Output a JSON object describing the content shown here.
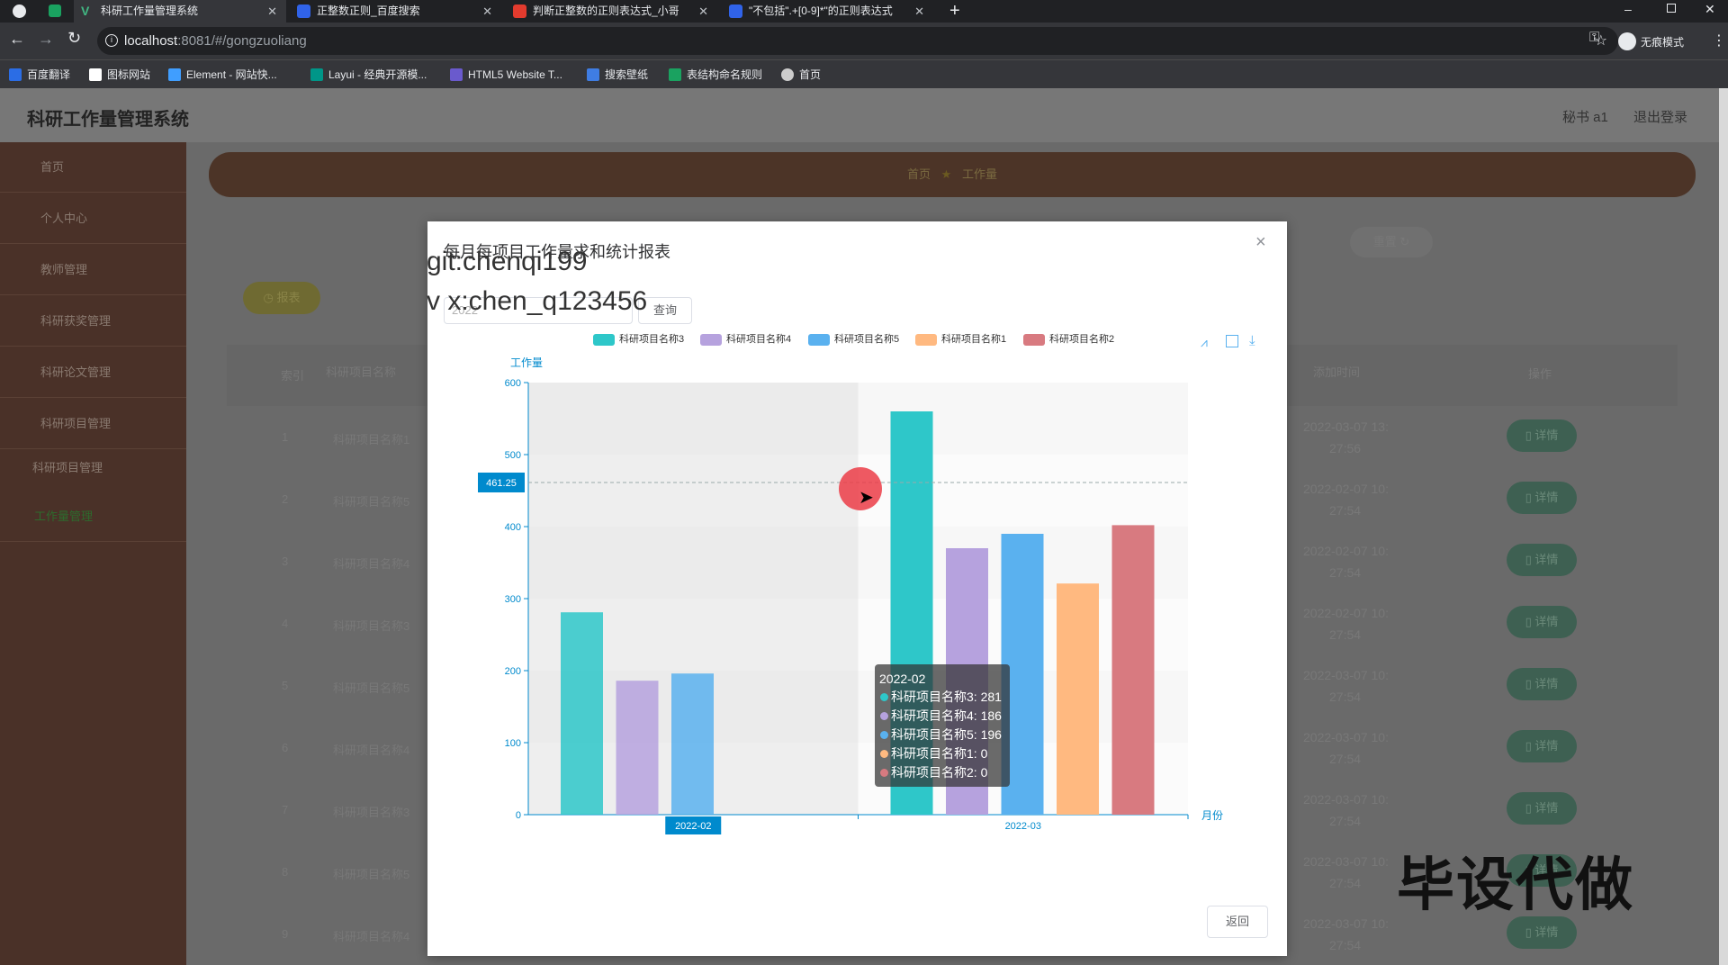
{
  "browser": {
    "tabs": [
      {
        "title": "科研工作量管理系统",
        "active": true,
        "fav": "#1aa260"
      },
      {
        "title": "正整数正则_百度搜索",
        "active": false,
        "fav": "#3063e9"
      },
      {
        "title": "判断正整数的正则表达式_小哥",
        "active": false,
        "fav": "#e33b2e"
      },
      {
        "title": "\"不包括\".+[0-9]*\"的正则表达式",
        "active": false,
        "fav": "#3063e9"
      }
    ],
    "url_host": "localhost",
    "url_rest": ":8081/#/gongzuoliang",
    "incognito_label": "无痕模式",
    "bookmarks": [
      {
        "label": "百度翻译",
        "color": "#2b6de5"
      },
      {
        "label": "图标网站",
        "color": "#ffffff"
      },
      {
        "label": "Element - 网站快...",
        "color": "#409eff"
      },
      {
        "label": "Layui - 经典开源模...",
        "color": "#009688"
      },
      {
        "label": "HTML5 Website T...",
        "color": "#6a5acd"
      },
      {
        "label": "搜索壁纸",
        "color": "#3f7de3"
      },
      {
        "label": "表结构命名规则",
        "color": "#1aa260"
      },
      {
        "label": "首页",
        "color": "#cccccc"
      }
    ]
  },
  "app": {
    "title": "科研工作量管理系统",
    "user": "秘书 a1",
    "logout": "退出登录",
    "menu": [
      "首页",
      "个人中心",
      "教师管理",
      "科研获奖管理",
      "科研论文管理",
      "科研项目管理",
      "科研项目管理",
      "工作量管理"
    ],
    "breadcrumb_home": "首页",
    "breadcrumb_current": "工作量",
    "reset_label": "重置",
    "report_label": "报表",
    "table": {
      "headers": [
        "索引",
        "科研项目名称",
        "添加时间",
        "操作"
      ],
      "rows": [
        {
          "index": "1",
          "name": "科研项目名称1",
          "time1": "2022-03-07 13:",
          "time2": "27:56"
        },
        {
          "index": "2",
          "name": "科研项目名称5",
          "time1": "2022-02-07 10:",
          "time2": "27:54"
        },
        {
          "index": "3",
          "name": "科研项目名称4",
          "time1": "2022-02-07 10:",
          "time2": "27:54"
        },
        {
          "index": "4",
          "name": "科研项目名称3",
          "time1": "2022-02-07 10:",
          "time2": "27:54"
        },
        {
          "index": "5",
          "name": "科研项目名称5",
          "time1": "2022-03-07 10:",
          "time2": "27:54"
        },
        {
          "index": "6",
          "name": "科研项目名称4",
          "time1": "2022-03-07 10:",
          "time2": "27:54"
        },
        {
          "index": "7",
          "name": "科研项目名称3",
          "time1": "2022-03-07 10:",
          "time2": "27:54"
        },
        {
          "index": "8",
          "name": "科研项目名称5",
          "time1": "2022-03-07 10:",
          "time2": "27:54"
        },
        {
          "index": "9",
          "name": "科研项目名称4",
          "time1": "2022-03-07 10:",
          "time2": "27:54"
        }
      ],
      "detail_label": "详情"
    }
  },
  "modal": {
    "title": "每月每项目工作量求和统计报表",
    "close": "×",
    "year_value": "2022",
    "query_label": "查询",
    "back_label": "返回"
  },
  "watermarks": {
    "line1": "git:chenqi199",
    "line2": "v x:chen_q123456",
    "corner": "毕设代做"
  },
  "tooltip": {
    "title": "2022-02",
    "rows": [
      "科研项目名称3: 281",
      "科研项目名称4: 186",
      "科研项目名称5: 196",
      "科研项目名称1: 0",
      "科研项目名称2: 0"
    ]
  },
  "chart_data": {
    "type": "bar",
    "ylabel": "工作量",
    "xlabel": "月份",
    "categories": [
      "2022-02",
      "2022-03"
    ],
    "ylim": [
      0,
      600
    ],
    "yticks": [
      0,
      100,
      200,
      300,
      400,
      500,
      600
    ],
    "pointer_value": "461.25",
    "legend_position": "top",
    "series": [
      {
        "name": "科研项目名称3",
        "color": "#2ec7c9",
        "values": [
          281,
          560
        ]
      },
      {
        "name": "科研项目名称4",
        "color": "#b6a2de",
        "values": [
          186,
          370
        ]
      },
      {
        "name": "科研项目名称5",
        "color": "#5ab1ef",
        "values": [
          196,
          390
        ]
      },
      {
        "name": "科研项目名称1",
        "color": "#ffb980",
        "values": [
          0,
          321
        ]
      },
      {
        "name": "科研项目名称2",
        "color": "#d87a80",
        "values": [
          0,
          402
        ]
      }
    ]
  }
}
